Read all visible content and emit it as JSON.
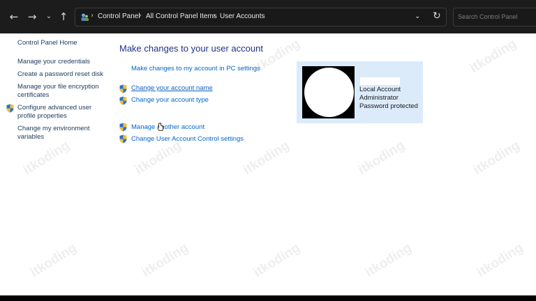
{
  "window": {
    "nav": {
      "back_icon": "arrow-left-icon",
      "forward_icon": "arrow-right-icon",
      "recent_icon": "chevron-down-icon",
      "up_icon": "arrow-up-icon"
    },
    "address_bar": {
      "icon": "control-panel-icon",
      "breadcrumbs": [
        "Control Panel",
        "All Control Panel Items",
        "User Accounts"
      ],
      "dropdown_icon": "chevron-down-icon",
      "refresh_icon": "refresh-icon"
    },
    "search": {
      "placeholder": "Search Control Panel"
    }
  },
  "sidebar": {
    "items": [
      {
        "label": "Control Panel Home"
      },
      {
        "label": "Manage your credentials"
      },
      {
        "label": "Create a password reset disk"
      },
      {
        "label_lines": [
          "Manage your file encryption",
          "certificates"
        ]
      },
      {
        "label_lines": [
          "Configure advanced user",
          "profile properties"
        ],
        "icon": "uac-shield-icon"
      },
      {
        "label_lines": [
          "Change my environment",
          "variables"
        ]
      }
    ]
  },
  "main": {
    "heading": "Make changes to your user account",
    "links": [
      {
        "label": "Make changes to my account in PC settings"
      },
      {
        "label": "Change your account name",
        "icon": "uac-shield-icon"
      },
      {
        "label": "Change your account type",
        "icon": "uac-shield-icon"
      },
      {
        "label": "Manage another account",
        "icon": "uac-shield-icon"
      },
      {
        "label": "Change User Account Control settings",
        "icon": "uac-shield-icon"
      }
    ]
  },
  "account": {
    "type": "Local Account",
    "role": "Administrator",
    "status": "Password protected"
  },
  "watermark": "itkoding",
  "colors": {
    "link": "#0066cc",
    "heading": "#1e3287",
    "account_panel": "#dcebfa",
    "titlebar": "#1c1c1c"
  }
}
